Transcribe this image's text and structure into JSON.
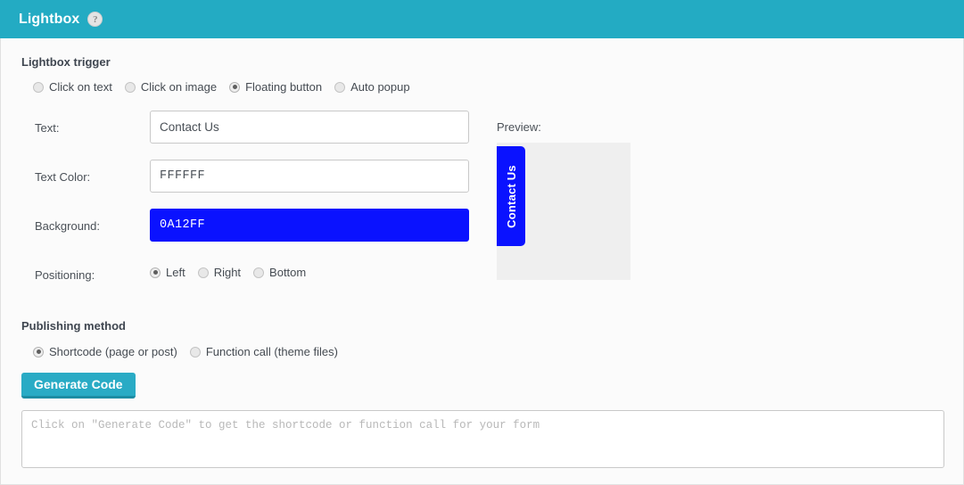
{
  "header": {
    "title": "Lightbox",
    "help_icon": "question-mark-icon",
    "help_glyph": "?",
    "background_color": "#23ABC3"
  },
  "trigger_section": {
    "heading": "Lightbox trigger",
    "options": [
      {
        "label": "Click on text",
        "selected": false
      },
      {
        "label": "Click on image",
        "selected": false
      },
      {
        "label": "Floating button",
        "selected": true
      },
      {
        "label": "Auto popup",
        "selected": false
      }
    ]
  },
  "fields": {
    "text": {
      "label": "Text:",
      "value": "Contact Us"
    },
    "text_color": {
      "label": "Text Color:",
      "value": "FFFFFF"
    },
    "background": {
      "label": "Background:",
      "value": "0A12FF",
      "swatch_color": "#0A12FF",
      "swatch_text_color": "#FFFFFF"
    },
    "positioning": {
      "label": "Positioning:",
      "options": [
        {
          "label": "Left",
          "selected": true
        },
        {
          "label": "Right",
          "selected": false
        },
        {
          "label": "Bottom",
          "selected": false
        }
      ]
    }
  },
  "preview": {
    "label": "Preview:",
    "tab_text": "Contact Us",
    "tab_color": "#0A12FF",
    "tab_text_color": "#FFFFFF",
    "canvas_color": "#EFEFEF",
    "tab_position": "Left"
  },
  "publishing_section": {
    "heading": "Publishing method",
    "options": [
      {
        "label": "Shortcode (page or post)",
        "selected": true
      },
      {
        "label": "Function call (theme files)",
        "selected": false
      }
    ],
    "generate_button_label": "Generate Code",
    "generate_button_color": "#29ABC5"
  },
  "code_output": {
    "value": "",
    "placeholder": "Click on \"Generate Code\" to get the shortcode or function call for your form"
  }
}
